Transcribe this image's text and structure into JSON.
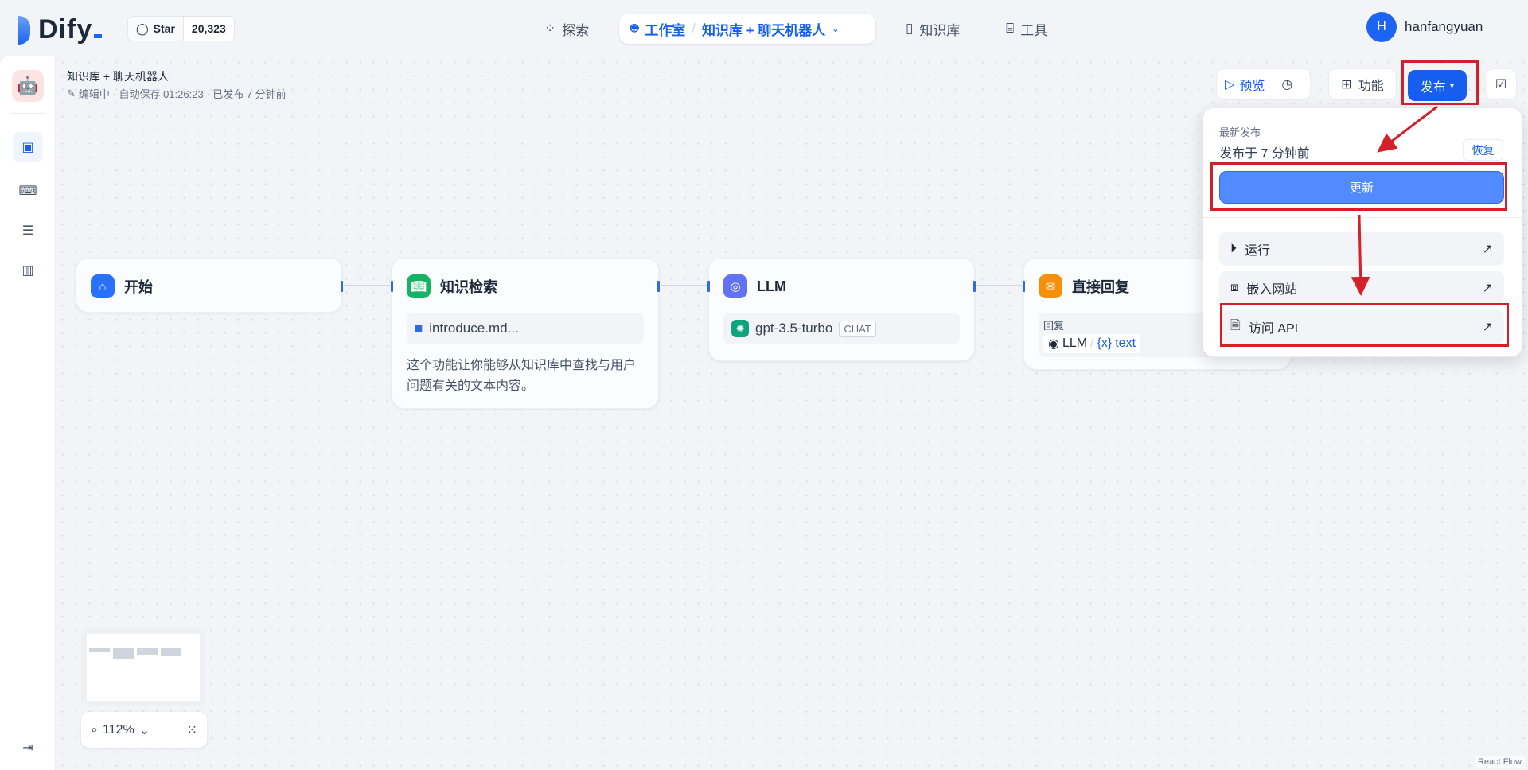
{
  "header": {
    "logo": "Dify",
    "github_star_label": "Star",
    "github_star_count": "20,323",
    "nav": {
      "explore": "探索",
      "studio": "工作室",
      "breadcrumb_app": "知识库 + 聊天机器人",
      "datasets": "知识库",
      "tools": "工具"
    },
    "user": {
      "initial": "H",
      "name": "hanfangyuan"
    }
  },
  "app": {
    "title": "知识库 + 聊天机器人",
    "status": "编辑中 · 自动保存 01:26:23 · 已发布 7 分钟前"
  },
  "toolbar": {
    "preview": "预览",
    "features": "功能",
    "publish": "发布"
  },
  "publish_menu": {
    "latest_label": "最新发布",
    "published_time": "发布于 7 分钟前",
    "restore": "恢复",
    "update": "更新",
    "items": [
      {
        "label": "运行",
        "icon": "play-circle-icon"
      },
      {
        "label": "嵌入网站",
        "icon": "embed-icon"
      },
      {
        "label": "访问 API",
        "icon": "file-icon"
      }
    ]
  },
  "nodes": {
    "start": {
      "title": "开始"
    },
    "knowledge": {
      "title": "知识检索",
      "dataset": "introduce.md...",
      "desc": "这个功能让你能够从知识库中查找与用户问题有关的文本内容。"
    },
    "llm": {
      "title": "LLM",
      "model": "gpt-3.5-turbo",
      "mode": "CHAT"
    },
    "answer": {
      "title": "直接回复",
      "label": "回复",
      "var_node": "LLM",
      "var_sep": "/",
      "var_name": "text"
    }
  },
  "zoom": {
    "level": "112%"
  },
  "attribution": "React Flow",
  "colors": {
    "primary": "#155eef",
    "annotation": "#d42028",
    "start": "#2970ff",
    "knowledge": "#16b364",
    "llm": "#6172f3",
    "answer": "#f79009"
  }
}
